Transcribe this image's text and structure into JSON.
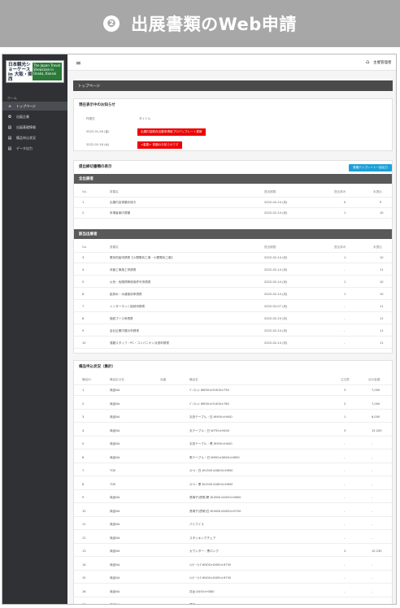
{
  "banner": {
    "number": "❷",
    "title": "出展書類のWeb申請"
  },
  "sidebar": {
    "logo_left": "日本観光ショーケース in 大阪・関西",
    "logo_right": "The Japan Travel Showcase in Osaka, Kansai",
    "section_label": "ホーム",
    "items": [
      {
        "icon": "⌂",
        "label": "トップページ"
      },
      {
        "icon": "✿",
        "label": "出展企業"
      },
      {
        "icon": "▤",
        "label": "出展基礎情報"
      },
      {
        "icon": "▤",
        "label": "備品申込状況"
      },
      {
        "icon": "▤",
        "label": "データ出力"
      }
    ]
  },
  "topbar": {
    "menu_icon": "≡",
    "home_icon": "⌂",
    "user": "主催管理者"
  },
  "page_title": "トップページ",
  "notices": {
    "heading": "現在表示中のお知らせ",
    "col_date": "作成日",
    "col_title": "タイトル",
    "items": [
      {
        "date": "2022-01-28 (金)",
        "title": "出展内容既存出展申請用プロバンプレート更新"
      },
      {
        "date": "2022-02-16 (水)",
        "title": "<重要> 書類のお知らせです"
      }
    ]
  },
  "status": {
    "heading": "提出締切書類の表示",
    "download_btn": "書類テンプレート一括出力",
    "sections": [
      {
        "title": "全出展者",
        "headers": [
          "No.",
          "書類名",
          "提出期限",
          "提出済み",
          "未提出"
        ],
        "rows": [
          [
            "1",
            "出展内容書類手続き",
            "2022-02-14 (月)",
            "0",
            "9"
          ],
          [
            "2",
            "来場者案内書類",
            "2022-02-14 (月)",
            "1",
            "10"
          ]
        ]
      },
      {
        "title": "該当出展者",
        "headers": [
          "No.",
          "書類名",
          "提出期限",
          "提出済み",
          "未提出"
        ],
        "rows": [
          [
            "3",
            "電気供給申請書【小間電気工事・小間電気工事】",
            "2022-02-14 (月)",
            "1",
            "10"
          ],
          [
            "4",
            "床面工事施工申請書",
            "2022-02-14 (月)",
            "-",
            "11"
          ],
          [
            "5",
            "火気・危険物等使用許可申請書",
            "2022-02-14 (月)",
            "1",
            "10"
          ],
          [
            "6",
            "給排水・水道使用申請書",
            "2022-02-14 (月)",
            "1",
            "10"
          ],
          [
            "7",
            "インターネット接続申請書",
            "2022-02-07 (月)",
            "-",
            "11"
          ],
          [
            "8",
            "施設ブース申請書",
            "2022-02-14 (月)",
            "-",
            "11"
          ],
          [
            "9",
            "会社企業内展示申請書",
            "2022-02-14 (月)",
            "-",
            "11"
          ],
          [
            "10",
            "運搬スタッフ・PC・コンパニオン派遣申請書",
            "2022-02-14 (月)",
            "-",
            "11"
          ]
        ]
      }
    ]
  },
  "equipment": {
    "heading": "備品申込状況（集計）",
    "headers": [
      "備品ID",
      "備品区分名",
      "品番",
      "備品名",
      "注文数",
      "合計金額"
    ],
    "rows": [
      [
        "1",
        "商品NA",
        "",
        "ﾊﾟﾝﾌﾚｯﾄ W630×H1400×T30",
        "3",
        "7,000"
      ],
      [
        "2",
        "商品NA",
        "",
        "ﾊﾟﾝﾌﾚｯﾄ W630×H1400×T60",
        "2",
        "7,000"
      ],
      [
        "3",
        "商品NA",
        "",
        "丸形テーブル・白 W900×H400",
        "1",
        "6,050"
      ],
      [
        "4",
        "商品NA",
        "",
        "丸テーブル・白 W750×H400",
        "3",
        "15,200"
      ],
      [
        "5",
        "商品NA",
        "",
        "丸形テーブル・黒 W900×H400",
        "-",
        "-"
      ],
      [
        "6",
        "商品NA",
        "",
        "角テーブル・白 W900×D600×H650",
        "-",
        "-"
      ],
      [
        "7",
        "TGE",
        "",
        "ｽﾂｰﾙ・白 W1500×D600×H650",
        "-",
        "-"
      ],
      [
        "8",
        "TGE",
        "",
        "ｽﾂｰﾙ・黒 W1500×D600×H650",
        "-",
        "-"
      ],
      [
        "9",
        "商品NA",
        "",
        "長椅子(透明)黒 W1800×D450×H800",
        "-",
        "-"
      ],
      [
        "10",
        "商品NA",
        "",
        "長椅子(透明)白 W1800×D450×H700",
        "-",
        "-"
      ],
      [
        "11",
        "商品NA",
        "",
        "パイプイス",
        "-",
        "-"
      ],
      [
        "12",
        "商品NA",
        "",
        "スタッキングチェア",
        "-",
        "-"
      ],
      [
        "13",
        "商品NA",
        "",
        "カウンター・黒ロング",
        "3",
        "10,230"
      ],
      [
        "14",
        "商品NA",
        "",
        "ﾊﾝｶﾞｰﾗｯｸ W300×D450×H750",
        "-",
        "-"
      ],
      [
        "15",
        "商品NA",
        "",
        "ﾊﾝｶﾞｰﾗｯｸ W400×D450×H750",
        "-",
        "-"
      ],
      [
        "16",
        "商品NA",
        "",
        "花台 D450×H380",
        "-",
        "-"
      ],
      [
        "17",
        "商品NA",
        "",
        "看板",
        "-",
        "-"
      ]
    ]
  }
}
